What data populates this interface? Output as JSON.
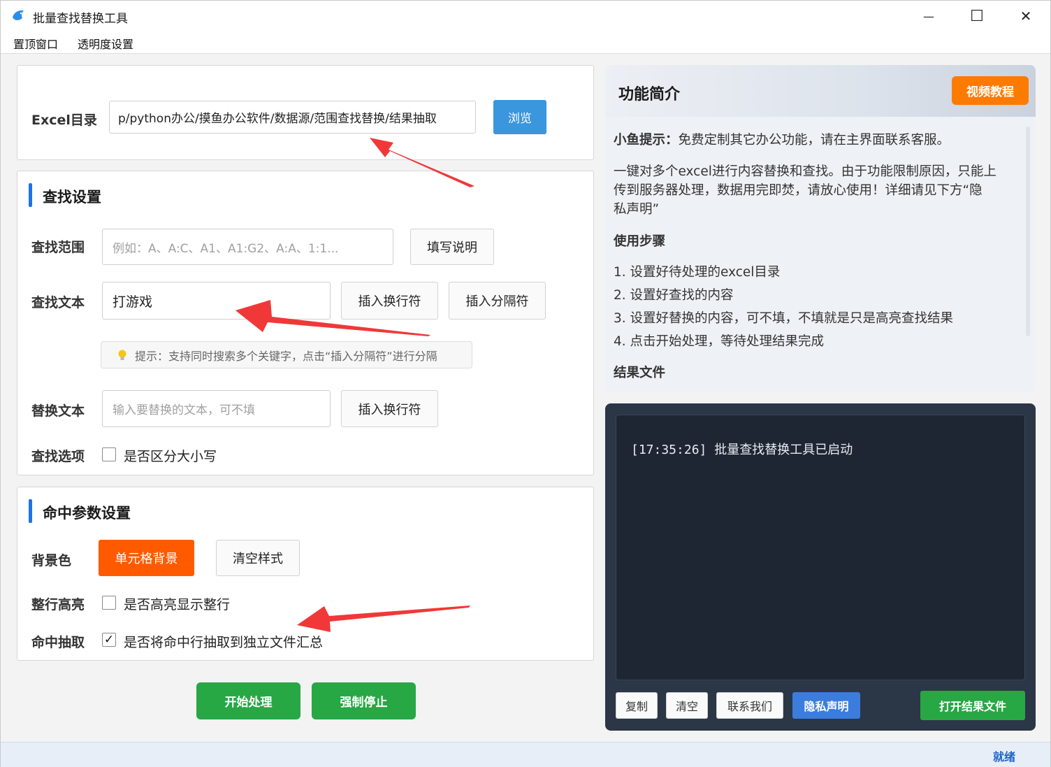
{
  "window": {
    "title": "批量查找替换工具",
    "minimize": "—",
    "maximize": "☐",
    "close": "✕"
  },
  "menu": [
    "置顶窗口",
    "透明度设置"
  ],
  "excel": {
    "label": "Excel目录",
    "path": "p/python办公/摸鱼办公软件/数据源/范围查找替换/结果抽取",
    "browse": "浏览"
  },
  "find": {
    "title": "查找设置",
    "range_label": "查找范围",
    "range_placeholder": "例如：A、A:C、A1、A1:G2、A:A、1:1...",
    "fill_help": "填写说明",
    "text_label": "查找文本",
    "text_value": "打游戏",
    "insert_newline": "插入换行符",
    "insert_sep": "插入分隔符",
    "tip": "提示：支持同时搜索多个关键字，点击“插入分隔符”进行分隔",
    "replace_label": "替换文本",
    "replace_placeholder": "输入要替换的文本，可不填",
    "replace_insert_newline": "插入换行符",
    "option_label": "查找选项",
    "case_label": "是否区分大小写"
  },
  "hit": {
    "title": "命中参数设置",
    "bg_label": "背景色",
    "cell_bg": "单元格背景",
    "clear_style": "清空样式",
    "row_label": "整行高亮",
    "row_check": "是否高亮显示整行",
    "extract_label": "命中抽取",
    "extract_check": "是否将命中行抽取到独立文件汇总",
    "extract_checked": "✓"
  },
  "actions": {
    "start": "开始处理",
    "stop": "强制停止"
  },
  "intro": {
    "title": "功能简介",
    "video": "视频教程",
    "tip_bold": "小鱼提示：",
    "tip_text": "免费定制其它办公功能，请在主界面联系客服。",
    "desc1": "一键对多个excel进行内容替换和查找。由于功能限制原因，只能上",
    "desc2": "传到服务器处理，数据用完即焚，请放心使用！详细请见下方“隐",
    "desc3": "私声明”",
    "steps_title": "使用步骤",
    "steps": [
      "1. 设置好待处理的excel目录",
      "2. 设置好查找的内容",
      "3. 设置好替换的内容，可不填，不填就是只是高亮查找结果",
      "4. 点击开始处理，等待处理结果完成"
    ],
    "result_title": "结果文件"
  },
  "log": {
    "time": "[17:35:26]",
    "message": "批量查找替换工具已启动",
    "copy": "复制",
    "clear": "清空",
    "contact": "联系我们",
    "privacy": "隐私声明",
    "open_result": "打开结果文件"
  },
  "status": "就绪",
  "colors": {
    "accent_blue": "#1e73e8",
    "orange": "#ff5a00",
    "green": "#28a745",
    "arrow_red": "#f03838"
  }
}
